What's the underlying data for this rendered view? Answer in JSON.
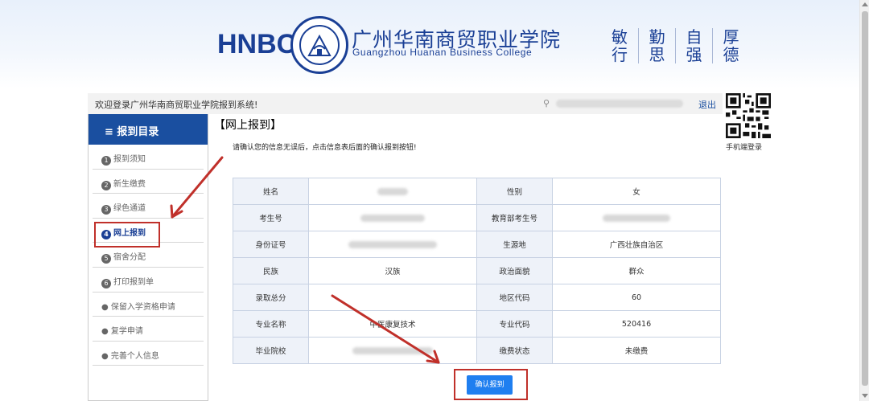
{
  "header": {
    "logo_abbr": "HNBC",
    "school_name_cn": "广州华南商贸职业学院",
    "school_name_en": "Guangzhou Huanan Business College",
    "motto": [
      [
        "敏",
        "行"
      ],
      [
        "勤",
        "思"
      ],
      [
        "自",
        "强"
      ],
      [
        "厚",
        "德"
      ]
    ]
  },
  "topbar": {
    "welcome": "欢迎登录广州华南商贸职业学院报到系统!",
    "logout": "退出"
  },
  "qr": {
    "label": "手机端登录"
  },
  "sidebar": {
    "title": "≡ 报到目录",
    "items": [
      {
        "num": "1",
        "label": "报到须知"
      },
      {
        "num": "2",
        "label": "新生缴费"
      },
      {
        "num": "3",
        "label": "绿色通道"
      },
      {
        "num": "4",
        "label": "网上报到"
      },
      {
        "num": "5",
        "label": "宿舍分配"
      },
      {
        "num": "6",
        "label": "打印报到单"
      },
      {
        "num": "●",
        "label": "保留入学资格申请"
      },
      {
        "num": "●",
        "label": "复学申请"
      },
      {
        "num": "●",
        "label": "完善个人信息"
      }
    ]
  },
  "main": {
    "title": "【网上报到】",
    "instruction": "请确认您的信息无误后，点击信息表后面的确认报到按钮!",
    "table": [
      {
        "l1": "姓名",
        "v1": "",
        "l2": "性别",
        "v2": "女"
      },
      {
        "l1": "考生号",
        "v1": "",
        "l2": "教育部考生号",
        "v2": ""
      },
      {
        "l1": "身份证号",
        "v1": "",
        "l2": "生源地",
        "v2": "广西壮族自治区"
      },
      {
        "l1": "民族",
        "v1": "汉族",
        "l2": "政治面貌",
        "v2": "群众"
      },
      {
        "l1": "录取总分",
        "v1": "",
        "l2": "地区代码",
        "v2": "60"
      },
      {
        "l1": "专业名称",
        "v1": "中医康复技术",
        "l2": "专业代码",
        "v2": "520416"
      },
      {
        "l1": "毕业院校",
        "v1": "",
        "l2": "缴费状态",
        "v2": "未缴费"
      }
    ],
    "confirm_button": "确认报到"
  },
  "colors": {
    "brand": "#1a3f95",
    "sidebar_head": "#1a4fa0",
    "button": "#1f7ff0",
    "annotation": "#c0302a"
  }
}
